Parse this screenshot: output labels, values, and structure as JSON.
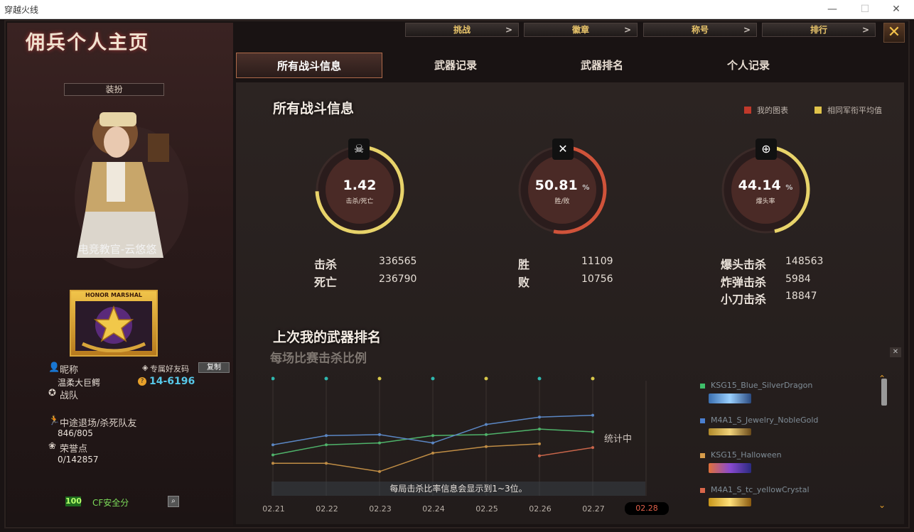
{
  "window": {
    "title": "穿越火线",
    "minimize": "—",
    "maximize": "☐",
    "close": "✕"
  },
  "page": {
    "title": "佣兵个人主页",
    "close_icon": "✕"
  },
  "top_buttons": [
    {
      "label": "挑战",
      "arrow": ">"
    },
    {
      "label": "徽章",
      "arrow": ">"
    },
    {
      "label": "称号",
      "arrow": ">"
    },
    {
      "label": "排行",
      "arrow": ">"
    }
  ],
  "tabs": [
    "所有战斗信息",
    "武器记录",
    "武器排名",
    "个人记录"
  ],
  "profile": {
    "outfit_label": "装扮",
    "character_name": "电竞教官-云悠悠",
    "badge_label": "HONOR MARSHAL",
    "nickname_label": "昵称",
    "nickname": "温柔大巨鳄",
    "friend_code_label": "专属好友码",
    "friend_code": "14-6196",
    "copy_label": "复制",
    "team_label": "战队",
    "quit_label": "中途退场/杀死队友",
    "quit_value": "846/805",
    "honor_label": "荣誉点",
    "honor_value": "0/142857",
    "safety_score": "100",
    "safety_label": "CF安全分"
  },
  "battle": {
    "title": "所有战斗信息",
    "legend_mine": "我的图表",
    "legend_avg": "相同军衔平均值",
    "colors": {
      "mine": "#c0392b",
      "avg": "#e0c34a",
      "ring_red": "#d0533a",
      "ring_yellow": "#e8d36a"
    },
    "rings": [
      {
        "value": "1.42",
        "unit": "",
        "caption": "击杀/死亡",
        "icon": "skull-icon",
        "fraction": 0.72
      },
      {
        "value": "50.81",
        "unit": "%",
        "caption": "胜/败",
        "icon": "crossed-guns-icon",
        "fraction": 0.5081
      },
      {
        "value": "44.14",
        "unit": "%",
        "caption": "爆头率",
        "icon": "crosshair-gun-icon",
        "fraction": 0.4414
      }
    ],
    "stats_col1": [
      {
        "label": "击杀",
        "value": "336565"
      },
      {
        "label": "死亡",
        "value": "236790"
      }
    ],
    "stats_col2": [
      {
        "label": "胜",
        "value": "11109"
      },
      {
        "label": "败",
        "value": "10756"
      }
    ],
    "stats_col3": [
      {
        "label": "爆头击杀",
        "value": "148563"
      },
      {
        "label": "炸弹击杀",
        "value": "5984"
      },
      {
        "label": "小刀击杀",
        "value": "18847"
      }
    ]
  },
  "weapon_rank": {
    "title": "上次我的武器排名",
    "subtitle": "每场比赛击杀比例",
    "collecting": "统计中",
    "note": "每局击杀比率信息会显示到1~3位。",
    "close": "✕",
    "weapons": [
      {
        "name": "KSG15_Blue_SilverDragon",
        "color": "#3fbf6a"
      },
      {
        "name": "M4A1_S_Jewelry_NobleGold",
        "color": "#4a7fd0"
      },
      {
        "name": "KSG15_Halloween",
        "color": "#d79c4a"
      },
      {
        "name": "M4A1_S_tc_yellowCrystal",
        "color": "#d9664a"
      }
    ]
  },
  "chart_data": {
    "type": "line",
    "x": [
      "02.21",
      "02.22",
      "02.23",
      "02.24",
      "02.25",
      "02.26",
      "02.27",
      "02.28"
    ],
    "highlight_x": "02.28",
    "series": [
      {
        "name": "KSG15_Blue_SilverDragon",
        "color": "#4fb36a",
        "values": [
          0.35,
          0.46,
          0.48,
          0.56,
          0.57,
          0.63,
          0.6,
          null
        ]
      },
      {
        "name": "M4A1_S_Jewelry_NobleGold",
        "color": "#5b87c4",
        "values": [
          0.46,
          0.56,
          0.57,
          0.48,
          0.68,
          0.76,
          0.78,
          null
        ]
      },
      {
        "name": "KSG15_Halloween",
        "color": "#c08d45",
        "values": [
          0.26,
          0.26,
          0.17,
          0.37,
          0.44,
          0.47,
          null,
          null
        ]
      },
      {
        "name": "M4A1_S_tc_yellowCrystal",
        "color": "#c8654a",
        "values": [
          null,
          null,
          null,
          null,
          null,
          0.34,
          0.43,
          null
        ]
      }
    ],
    "markers": [
      {
        "x": "02.21",
        "color": "#2fb8b0"
      },
      {
        "x": "02.22",
        "color": "#2fb8b0"
      },
      {
        "x": "02.23",
        "color": "#d8c84a"
      },
      {
        "x": "02.24",
        "color": "#2fb8b0"
      },
      {
        "x": "02.25",
        "color": "#d8c84a"
      },
      {
        "x": "02.26",
        "color": "#2fb8b0"
      },
      {
        "x": "02.27",
        "color": "#d8c84a"
      }
    ],
    "ylim": [
      0,
      1
    ]
  }
}
